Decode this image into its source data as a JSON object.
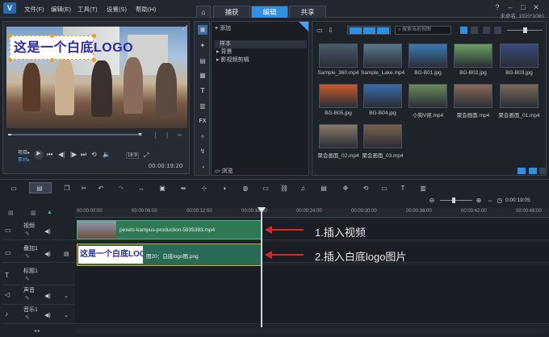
{
  "menu": {
    "file": "文件(F)",
    "edit": "编辑(E)",
    "tools": "工具(T)",
    "settings": "设置(S)",
    "help": "帮助(H)"
  },
  "tabs": [
    {
      "label": "捕获",
      "active": false
    },
    {
      "label": "编辑",
      "active": true
    },
    {
      "label": "共享",
      "active": false
    }
  ],
  "project_info": "未命名, 1920*1080",
  "preview": {
    "overlay_text": "这是一个白底LOGO",
    "mode_project": "项目▸",
    "mode_clip": "素材▸",
    "zoom": "16:9",
    "timecode": "00:00:19:20"
  },
  "library": {
    "add_label": "添加",
    "tree": [
      "样本",
      "背景",
      "影视频剪辑"
    ],
    "browse_label": "浏览",
    "search_placeholder": "搜索当前视图"
  },
  "media": [
    {
      "name": "Sample_360.mp4",
      "color": "#4a5a6a"
    },
    {
      "name": "Sample_Lake.mp4",
      "color": "#5a7a8a"
    },
    {
      "name": "BG-B01.jpg",
      "color": "#3a7ab8"
    },
    {
      "name": "BG-B02.jpg",
      "color": "#6aa060"
    },
    {
      "name": "BG-B03.jpg",
      "color": "#3a4a7a"
    },
    {
      "name": "BG-B05.jpg",
      "color": "#c85a2a"
    },
    {
      "name": "BG-B04.jpg",
      "color": "#3a6aa8"
    },
    {
      "name": "小狗V视.mp4",
      "color": "#6a8a5a"
    },
    {
      "name": "聚会画面.mp4",
      "color": "#8a6a5a"
    },
    {
      "name": "聚会画面_01.mp4",
      "color": "#7a6a5a"
    },
    {
      "name": "聚会画面_02.mp4",
      "color": "#8a7a6a"
    },
    {
      "name": "聚会画面_03.mp4",
      "color": "#7a6050"
    }
  ],
  "timeline": {
    "ruler": [
      "00:00:00:00",
      "00:00:06:00",
      "00:00:12:00",
      "00:00:18:00",
      "00:00:24:00",
      "00:00:30:00",
      "00:00:36:00",
      "00:00:42:00",
      "00:00:48:00"
    ],
    "zoom_timecode": "0:00:19:05",
    "tracks": [
      "视频",
      "叠加1",
      "标题1",
      "声音",
      "音乐1"
    ],
    "clip_video": "pexels-kampus-production-5935393.mp4",
    "clip_overlay_thumb": "这是一个白底LOGO",
    "clip_overlay_name": "图20：白底logo图.png"
  },
  "annotations": {
    "a1": "1.插入视频",
    "a2": "2.插入白底logo图片"
  }
}
